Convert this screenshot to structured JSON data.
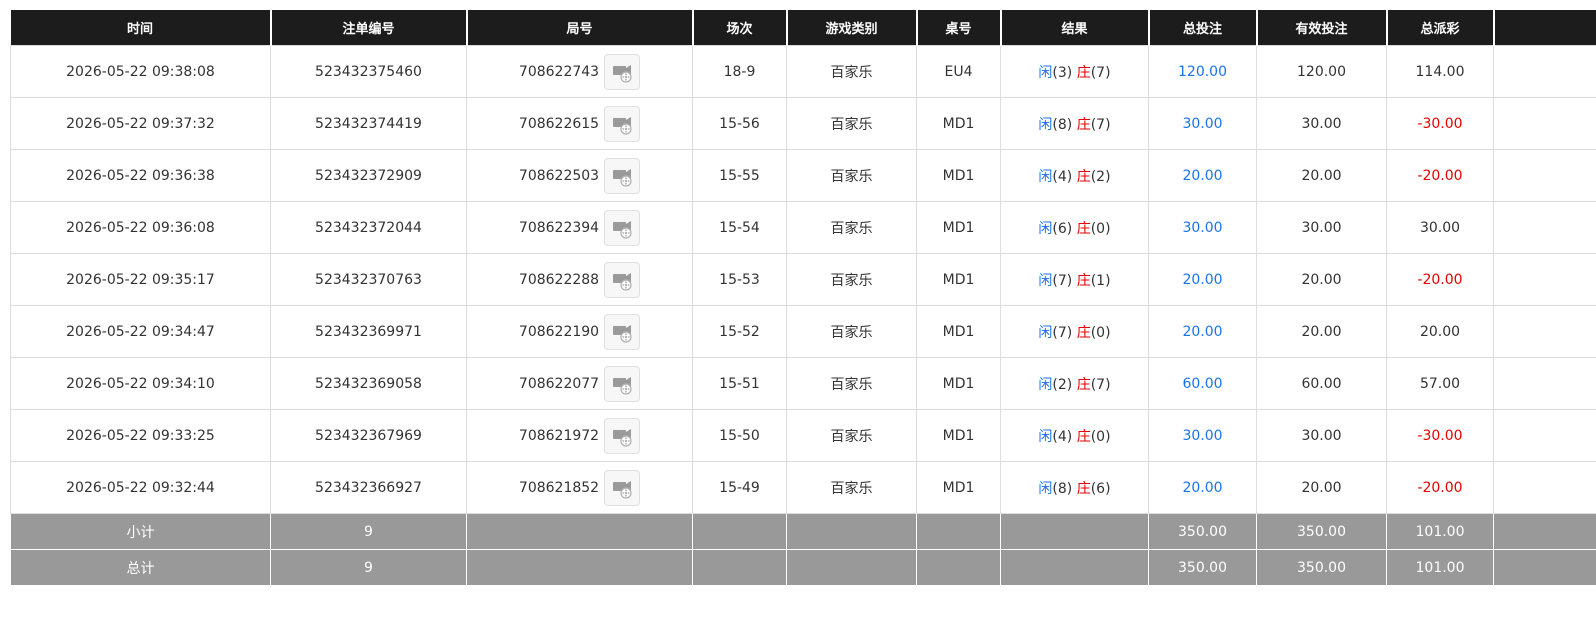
{
  "headers": [
    "时间",
    "注单编号",
    "局号",
    "场次",
    "游戏类别",
    "桌号",
    "结果",
    "总投注",
    "有效投注",
    "总派彩",
    ""
  ],
  "rows": [
    {
      "time": "2026-05-22 09:38:08",
      "bet_id": "523432375460",
      "round": "708622743",
      "shoe": "18-9",
      "game": "百家乐",
      "table": "EU4",
      "player_label": "闲",
      "player_score": "(3)",
      "banker_label": "庄",
      "banker_score": "(7)",
      "total_bet": "120.00",
      "valid_bet": "120.00",
      "payout": "114.00",
      "payout_color": "black"
    },
    {
      "time": "2026-05-22 09:37:32",
      "bet_id": "523432374419",
      "round": "708622615",
      "shoe": "15-56",
      "game": "百家乐",
      "table": "MD1",
      "player_label": "闲",
      "player_score": "(8)",
      "banker_label": "庄",
      "banker_score": "(7)",
      "total_bet": "30.00",
      "valid_bet": "30.00",
      "payout": "-30.00",
      "payout_color": "red"
    },
    {
      "time": "2026-05-22 09:36:38",
      "bet_id": "523432372909",
      "round": "708622503",
      "shoe": "15-55",
      "game": "百家乐",
      "table": "MD1",
      "player_label": "闲",
      "player_score": "(4)",
      "banker_label": "庄",
      "banker_score": "(2)",
      "total_bet": "20.00",
      "valid_bet": "20.00",
      "payout": "-20.00",
      "payout_color": "red"
    },
    {
      "time": "2026-05-22 09:36:08",
      "bet_id": "523432372044",
      "round": "708622394",
      "shoe": "15-54",
      "game": "百家乐",
      "table": "MD1",
      "player_label": "闲",
      "player_score": "(6)",
      "banker_label": "庄",
      "banker_score": "(0)",
      "total_bet": "30.00",
      "valid_bet": "30.00",
      "payout": "30.00",
      "payout_color": "black"
    },
    {
      "time": "2026-05-22 09:35:17",
      "bet_id": "523432370763",
      "round": "708622288",
      "shoe": "15-53",
      "game": "百家乐",
      "table": "MD1",
      "player_label": "闲",
      "player_score": "(7)",
      "banker_label": "庄",
      "banker_score": "(1)",
      "total_bet": "20.00",
      "valid_bet": "20.00",
      "payout": "-20.00",
      "payout_color": "red"
    },
    {
      "time": "2026-05-22 09:34:47",
      "bet_id": "523432369971",
      "round": "708622190",
      "shoe": "15-52",
      "game": "百家乐",
      "table": "MD1",
      "player_label": "闲",
      "player_score": "(7)",
      "banker_label": "庄",
      "banker_score": "(0)",
      "total_bet": "20.00",
      "valid_bet": "20.00",
      "payout": "20.00",
      "payout_color": "black"
    },
    {
      "time": "2026-05-22 09:34:10",
      "bet_id": "523432369058",
      "round": "708622077",
      "shoe": "15-51",
      "game": "百家乐",
      "table": "MD1",
      "player_label": "闲",
      "player_score": "(2)",
      "banker_label": "庄",
      "banker_score": "(7)",
      "total_bet": "60.00",
      "valid_bet": "60.00",
      "payout": "57.00",
      "payout_color": "black"
    },
    {
      "time": "2026-05-22 09:33:25",
      "bet_id": "523432367969",
      "round": "708621972",
      "shoe": "15-50",
      "game": "百家乐",
      "table": "MD1",
      "player_label": "闲",
      "player_score": "(4)",
      "banker_label": "庄",
      "banker_score": "(0)",
      "total_bet": "30.00",
      "valid_bet": "30.00",
      "payout": "-30.00",
      "payout_color": "red"
    },
    {
      "time": "2026-05-22 09:32:44",
      "bet_id": "523432366927",
      "round": "708621852",
      "shoe": "15-49",
      "game": "百家乐",
      "table": "MD1",
      "player_label": "闲",
      "player_score": "(8)",
      "banker_label": "庄",
      "banker_score": "(6)",
      "total_bet": "20.00",
      "valid_bet": "20.00",
      "payout": "-20.00",
      "payout_color": "red"
    }
  ],
  "subtotal": {
    "label": "小计",
    "count": "9",
    "total_bet": "350.00",
    "valid_bet": "350.00",
    "payout": "101.00"
  },
  "grandtotal": {
    "label": "总计",
    "count": "9",
    "total_bet": "350.00",
    "valid_bet": "350.00",
    "payout": "101.00"
  },
  "icons": {
    "replay": "video-replay-icon"
  },
  "colors": {
    "header_bg": "#1c1c1c",
    "summary_bg": "#999999",
    "player": "#1a73e8",
    "banker": "#e60000",
    "loss": "#e60000",
    "bet": "#1a73e8"
  }
}
